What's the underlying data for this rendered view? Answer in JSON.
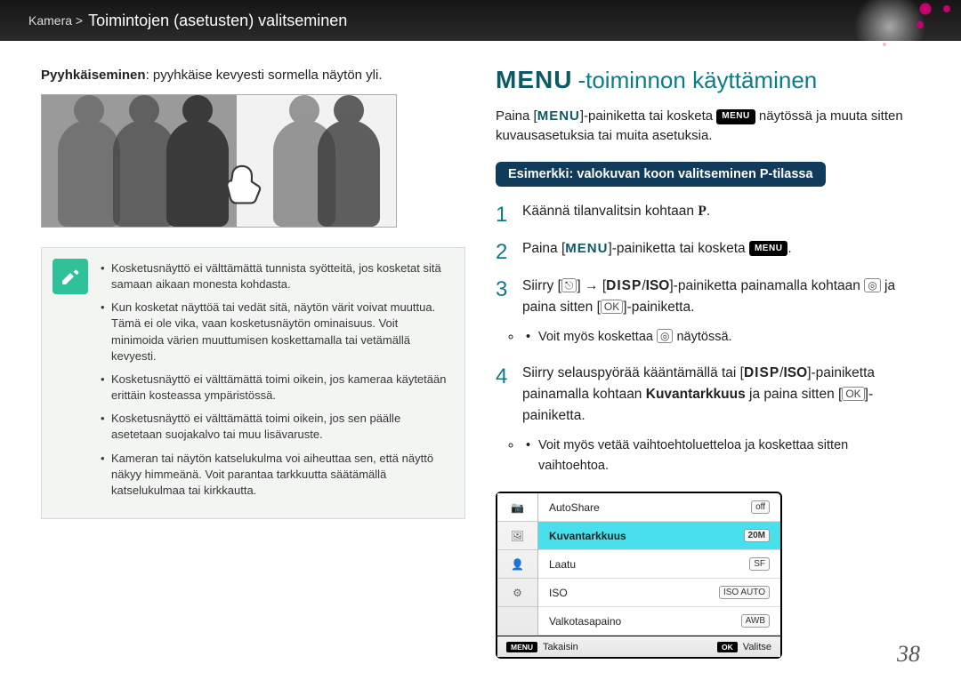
{
  "header": {
    "breadcrumb_prefix": "Kamera >",
    "breadcrumb_title": "Toimintojen (asetusten) valitseminen"
  },
  "left": {
    "swipe_label_bold": "Pyyhkäiseminen",
    "swipe_label_rest": ": pyyhkäise kevyesti sormella näytön yli.",
    "notes": [
      "Kosketusnäyttö ei välttämättä tunnista syötteitä, jos kosketat sitä samaan aikaan monesta kohdasta.",
      "Kun kosketat näyttöä tai vedät sitä, näytön värit voivat muuttua. Tämä ei ole vika, vaan kosketusnäytön ominaisuus. Voit minimoida värien muuttumisen koskettamalla tai vetämällä kevyesti.",
      "Kosketusnäyttö ei välttämättä toimi oikein, jos kameraa käytetään erittäin kosteassa ympäristössä.",
      "Kosketusnäyttö ei välttämättä toimi oikein, jos sen päälle asetetaan suojakalvo tai muu lisävaruste.",
      "Kameran tai näytön katselukulma voi aiheuttaa sen, että näyttö näkyy himmeänä. Voit parantaa tarkkuutta säätämällä katselukulmaa tai kirkkautta."
    ]
  },
  "right": {
    "heading_menu": "MENU",
    "heading_rest": "-toiminnon käyttäminen",
    "intro_a": "Paina [",
    "intro_b": "]-painiketta tai kosketa ",
    "intro_menu_btn": "MENU",
    "intro_c": " näytössä ja muuta sitten kuvausasetuksia tai muita asetuksia.",
    "example_bar": "Esimerkki: valokuvan koon valitseminen P-tilassa",
    "steps": {
      "s1_a": "Käännä tilanvalitsin kohtaan ",
      "s1_b": ".",
      "s2_a": "Paina [",
      "s2_b": "]-painiketta tai kosketa ",
      "s2_c": ".",
      "s3_a": "Siirry [",
      "s3_b": "] → [",
      "s3_disp": "DISP",
      "s3_iso": "ISO",
      "s3_c": "]-painiketta painamalla kohtaan ",
      "s3_d": " ja paina sitten [",
      "s3_e": "]-painiketta.",
      "s3_sub": "Voit myös koskettaa ",
      "s3_sub_b": " näytössä.",
      "s4_a": "Siirry selauspyörää kääntämällä tai [",
      "s4_b": "]-painiketta painamalla kohtaan ",
      "s4_target": "Kuvantarkkuus",
      "s4_c": " ja paina sitten [",
      "s4_d": "]-painiketta.",
      "s4_sub": "Voit myös vetää vaihtoehtoluetteloa ja koskettaa sitten vaihtoehtoa."
    },
    "menu_shot": {
      "tabs_glyphs": [
        "📷",
        "🖼",
        "👤",
        "⚙"
      ],
      "rows": [
        {
          "label": "AutoShare",
          "val_glyph": "off"
        },
        {
          "label": "Kuvantarkkuus",
          "val_glyph": "20M",
          "selected": true
        },
        {
          "label": "Laatu",
          "val_glyph": "SF"
        },
        {
          "label": "ISO",
          "val_glyph": "ISO AUTO"
        },
        {
          "label": "Valkotasapaino",
          "val_glyph": "AWB"
        }
      ],
      "foot_back_btn": "MENU",
      "foot_back": "Takaisin",
      "foot_ok_btn": "OK",
      "foot_ok": "Valitse"
    }
  },
  "page_number": "38",
  "glyphs": {
    "menu_word": "MENU",
    "P": "P",
    "camera": "⌂",
    "ok": "OK",
    "person": "⎋"
  }
}
